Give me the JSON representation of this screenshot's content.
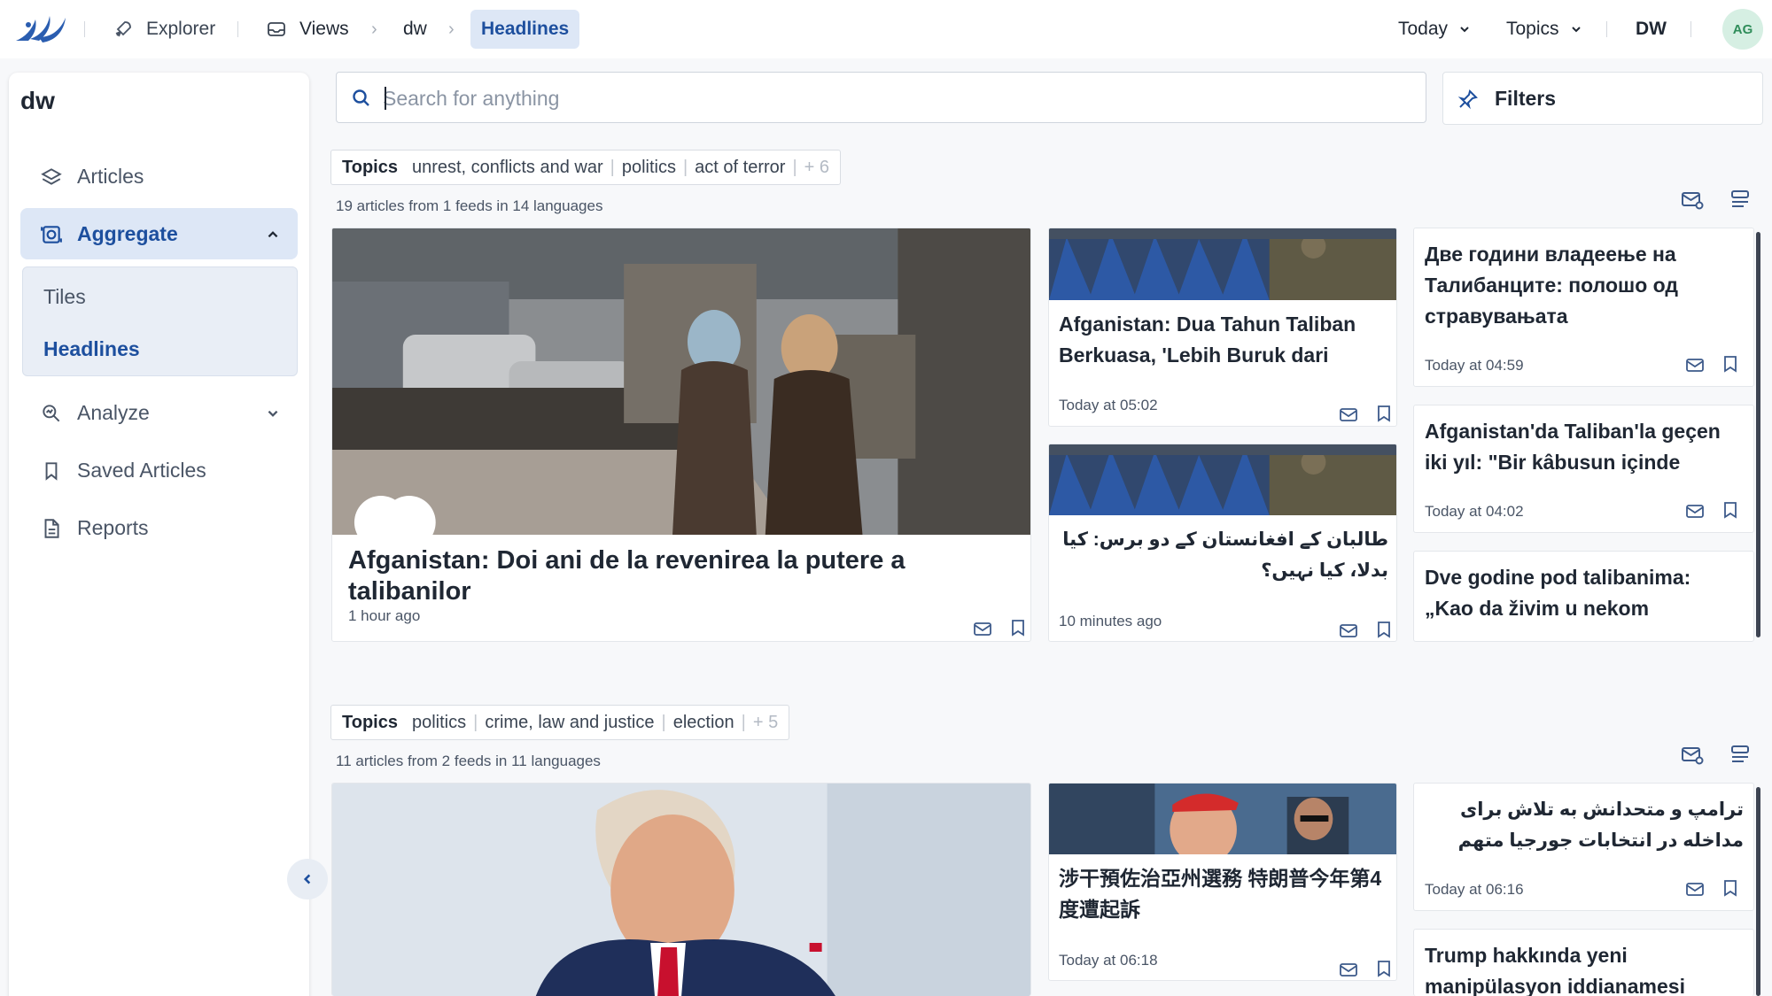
{
  "topbar": {
    "explorer": "Explorer",
    "views": "Views",
    "crumb_dw": "dw",
    "crumb_active": "Headlines",
    "today": "Today",
    "topics": "Topics",
    "user_code": "DW",
    "avatar": "AG"
  },
  "sidebar": {
    "title": "dw",
    "items": [
      {
        "label": "Articles",
        "icon": "layers-icon"
      },
      {
        "label": "Aggregate",
        "icon": "aggregate-icon"
      },
      {
        "label": "Analyze",
        "icon": "analyze-icon"
      },
      {
        "label": "Saved Articles",
        "icon": "bookmark-icon"
      },
      {
        "label": "Reports",
        "icon": "file-icon"
      }
    ],
    "sub_items": [
      "Tiles",
      "Headlines"
    ]
  },
  "search": {
    "placeholder": "Search for anything",
    "value": ""
  },
  "filters_label": "Filters",
  "groups": [
    {
      "topics_label": "Topics",
      "topics": [
        "unrest, conflicts and war",
        "politics",
        "act of terror"
      ],
      "more": "+ 6",
      "meta": "19 articles from 1 feeds in 14 languages",
      "main": {
        "title": "Afganistan: Doi ani de la revenirea la putere a talibanilor",
        "time": "1 hour ago"
      },
      "mid": [
        {
          "title": "Afganistan: Dua Tahun Taliban Berkuasa, 'Lebih Buruk dari yang…",
          "time": "Today at 05:02"
        },
        {
          "title": "طالبان کے افغانستان کے دو برس: کیا بدلا، کیا نہیں؟",
          "time": "10 minutes ago"
        }
      ],
      "side": [
        {
          "title": "Две години владеење на Талибанците: полошо од стравувањата",
          "time": "Today at 04:59"
        },
        {
          "title": "Afganistan'da Taliban'la geçen iki yıl: \"Bir kâbusun içinde gibiyim\"",
          "time": "Today at 04:02"
        },
        {
          "title": "Dve godine pod talibanima: „Kao da živim u nekom košmaru“",
          "time": ""
        }
      ]
    },
    {
      "topics_label": "Topics",
      "topics": [
        "politics",
        "crime, law and justice",
        "election"
      ],
      "more": "+ 5",
      "meta": "11 articles from 2 feeds in 11 languages",
      "mid": [
        {
          "title": "涉干預佐治亞州選務 特朗普今年第4度遭起訴",
          "time": "Today at 06:18"
        }
      ],
      "side": [
        {
          "title": "ترامپ و متحدانش به تلاش برای مداخله در انتخابات جورجیا متهم شدند",
          "time": "Today at 06:16"
        },
        {
          "title": "Trump hakkında yeni manipülasyon iddianamesi",
          "time": ""
        }
      ]
    }
  ],
  "colors": {
    "accent": "#1d4f9e",
    "accent_bg": "#dde7f6",
    "avatar_bg": "#d6efe3"
  }
}
